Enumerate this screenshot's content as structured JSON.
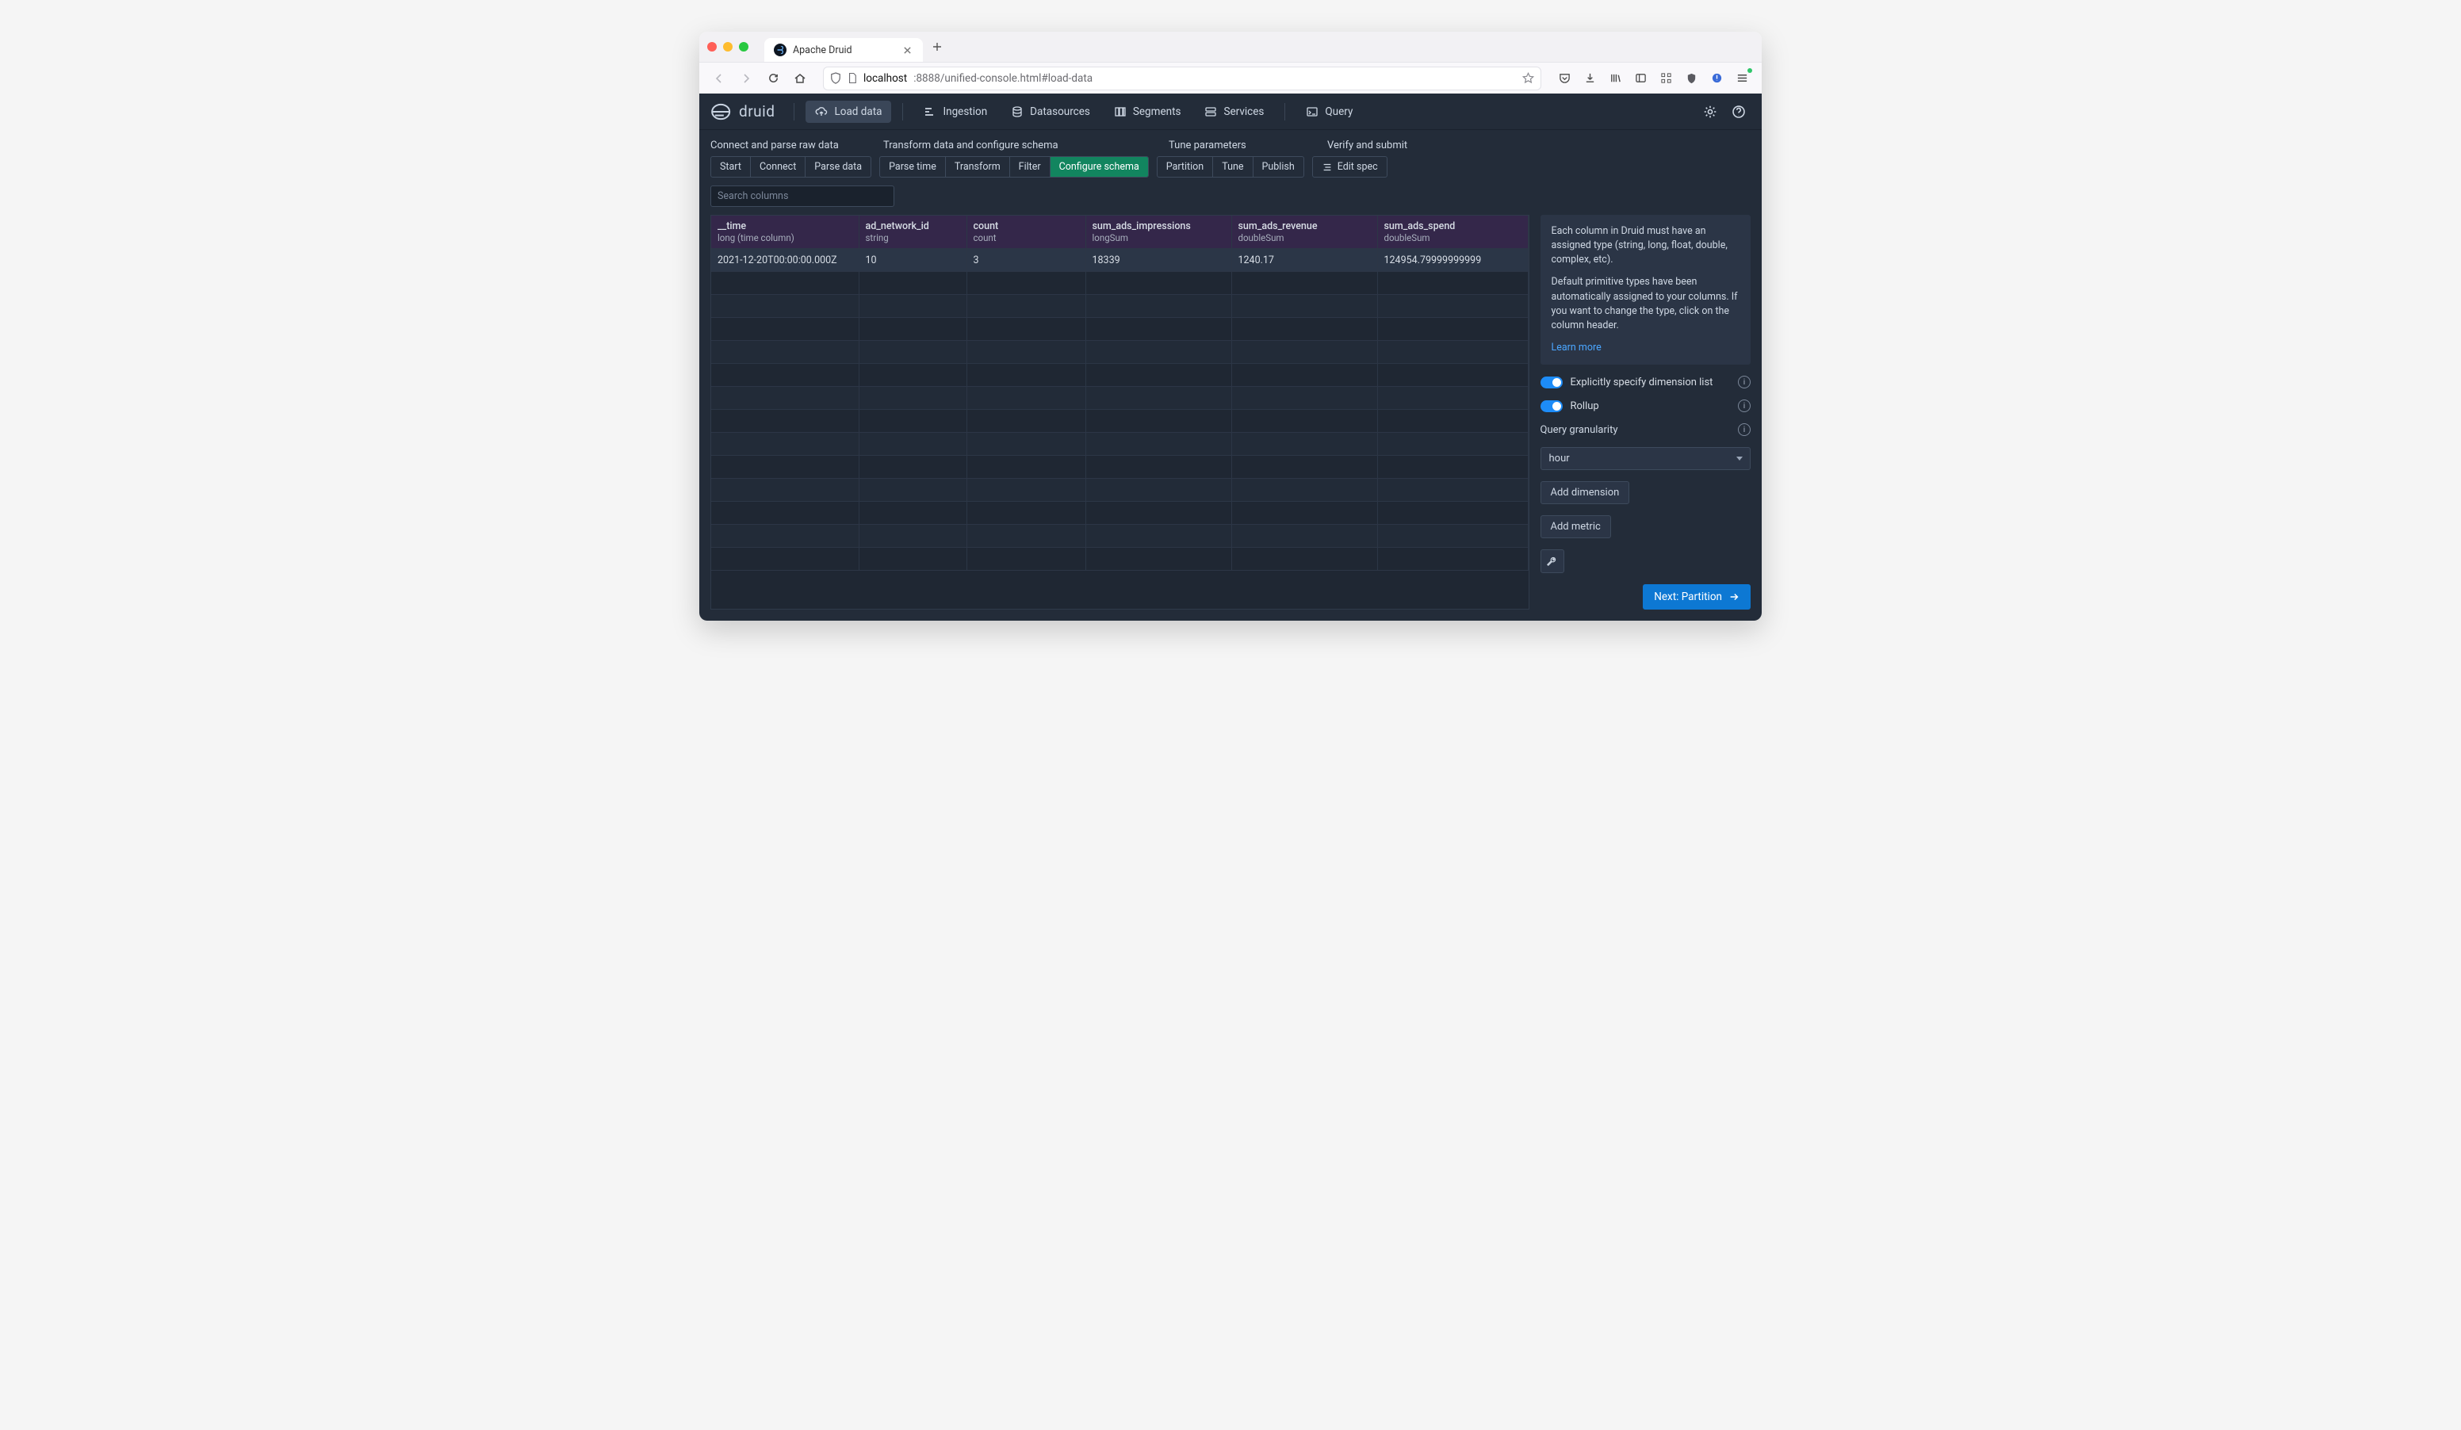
{
  "browser": {
    "tab_title": "Apache Druid",
    "url_host": "localhost",
    "url_path": ":8888/unified-console.html#load-data"
  },
  "nav": {
    "logo": "druid",
    "load_data": "Load data",
    "ingestion": "Ingestion",
    "datasources": "Datasources",
    "segments": "Segments",
    "services": "Services",
    "query": "Query"
  },
  "wizard": {
    "group1_label": "Connect and parse raw data",
    "group2_label": "Transform data and configure schema",
    "group3_label": "Tune parameters",
    "group4_label": "Verify and submit",
    "g1": [
      "Start",
      "Connect",
      "Parse data"
    ],
    "g2": [
      "Parse time",
      "Transform",
      "Filter",
      "Configure schema"
    ],
    "g3": [
      "Partition",
      "Tune",
      "Publish"
    ],
    "g4": [
      "Edit spec"
    ],
    "search_placeholder": "Search columns"
  },
  "columns": [
    {
      "name": "__time",
      "type": "long (time column)"
    },
    {
      "name": "ad_network_id",
      "type": "string"
    },
    {
      "name": "count",
      "type": "count"
    },
    {
      "name": "sum_ads_impressions",
      "type": "longSum"
    },
    {
      "name": "sum_ads_revenue",
      "type": "doubleSum"
    },
    {
      "name": "sum_ads_spend",
      "type": "doubleSum"
    }
  ],
  "row": {
    "time": "2021-12-20T00:00:00.000Z",
    "ad_network_id": "10",
    "count": "3",
    "impressions": "18339",
    "revenue": "1240.17",
    "spend": "124954.79999999999"
  },
  "panel": {
    "p1": "Each column in Druid must have an assigned type (string, long, float, double, complex, etc).",
    "p2": "Default primitive types have been automatically assigned to your columns. If you want to change the type, click on the column header.",
    "learn": "Learn more",
    "explicit": "Explicitly specify dimension list",
    "rollup": "Rollup",
    "qg_label": "Query granularity",
    "qg_value": "hour",
    "add_dim": "Add dimension",
    "add_metric": "Add metric",
    "next": "Next: Partition"
  }
}
